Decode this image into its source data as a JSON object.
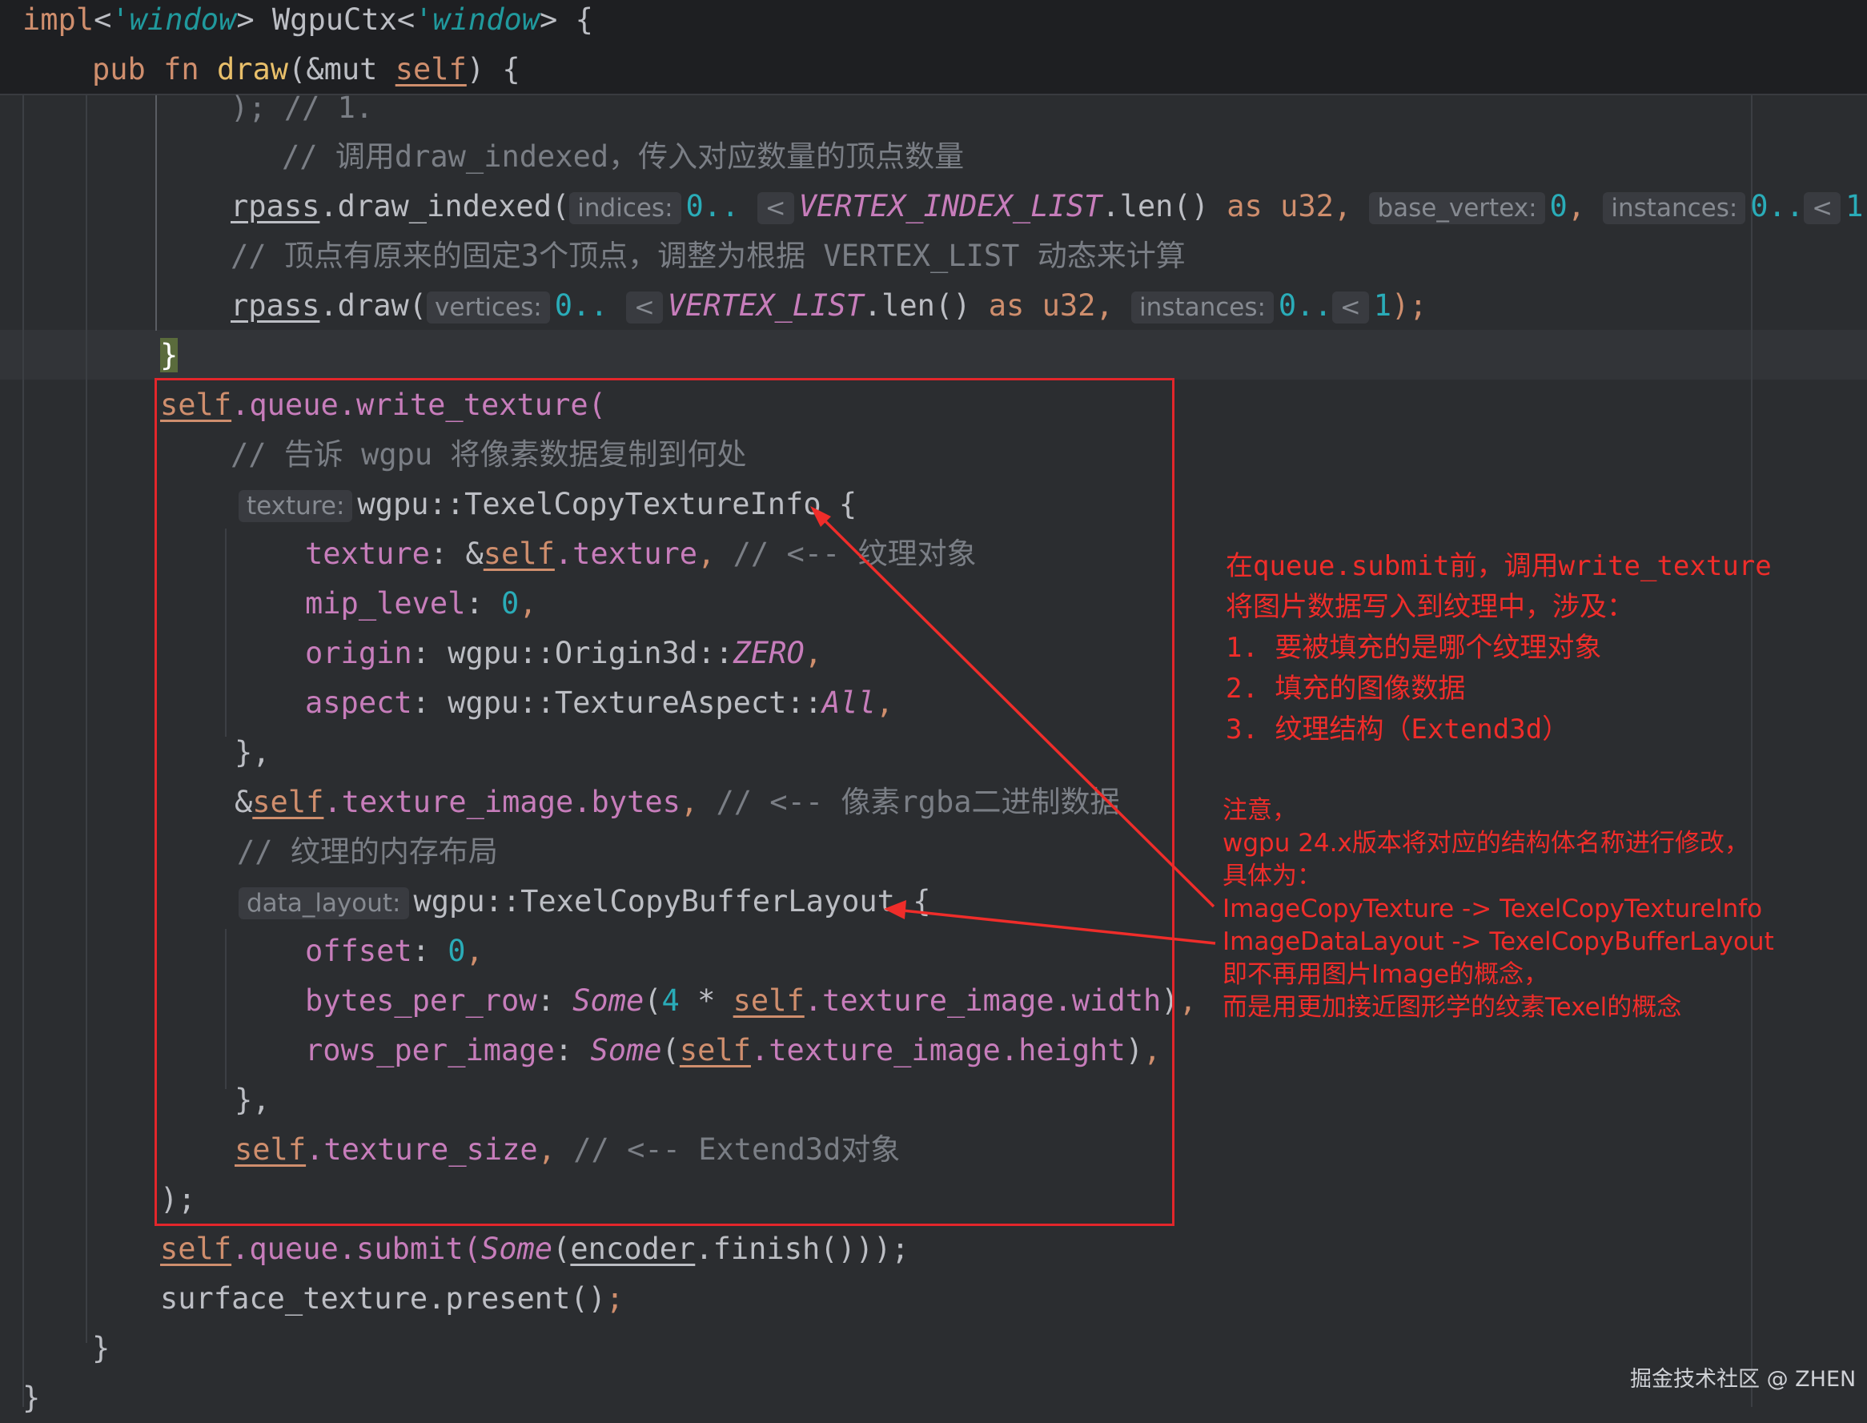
{
  "editor": {
    "sticky": {
      "impl_kw": "impl",
      "impl_lt1": "'window",
      "impl_type": "WgpuCtx<",
      "impl_lt2": "'window",
      "impl_tail": "> {",
      "fn_kw": "pub fn",
      "fn_name": "draw",
      "fn_params_a": "(&mut ",
      "fn_self": "self",
      "fn_params_b": ") {"
    },
    "lines": {
      "l_partial": "); // 1.",
      "l_cmt1": "// 调用draw_indexed，传入对应数量的顶点数量",
      "l_rpass1": "rpass",
      "l_draw_indexed": ".draw_indexed(",
      "h_indices": "indices:",
      "l_range1": "0..",
      "l_lt1": "<",
      "l_vil": "VERTEX_INDEX_LIST",
      "l_len1": ".len() ",
      "l_as1": "as u32",
      "l_comma": ",",
      "h_base_vertex": "base_vertex:",
      "l_zero": "0",
      "h_instances": "instances:",
      "l_range2": "0..",
      "l_one": "1",
      "l_close1": ");",
      "l_cmt2": "// 顶点有原来的固定3个顶点，调整为根据 VERTEX_LIST 动态来计算",
      "l_rpass2": "rpass",
      "l_draw": ".draw(",
      "h_vertices": "vertices:",
      "l_vl": "VERTEX_LIST",
      "l_brace_close": "}",
      "l_self_queue": ".queue.write_texture(",
      "l_cmt3": "// 告诉 wgpu 将像素数据复制到何处",
      "h_texture": "texture:",
      "l_tcti": "wgpu::TexelCopyTextureInfo {",
      "l_tex_field": "texture",
      "l_tex_val": ": &",
      "l_tex_val2": ".texture",
      "l_cmt4": "// <-- 纹理对象",
      "l_mip": "mip_level",
      "l_origin": "origin",
      "l_origin_val": ": wgpu::Origin3d::",
      "l_zero_const": "ZERO",
      "l_aspect": "aspect",
      "l_aspect_val": ": wgpu::TextureAspect::",
      "l_all": "All",
      "l_close_brace_comma": "},",
      "l_bytes_a": "&",
      "l_bytes_b": ".texture_image.bytes",
      "l_cmt5": "// <-- 像素rgba二进制数据",
      "l_cmt6": "// 纹理的内存布局",
      "h_data_layout": "data_layout:",
      "l_tcbl": "wgpu::TexelCopyBufferLayout {",
      "l_offset": "offset",
      "l_bpr": "bytes_per_row",
      "l_some": "Some",
      "l_four": "4",
      "l_star": " * ",
      "l_width": ".texture_image.width",
      "l_rpi": "rows_per_image",
      "l_height": ".texture_image.height",
      "l_tsize": ".texture_size",
      "l_cmt7": "// <-- Extend3d对象",
      "l_paren_semi": ");",
      "l_submit_a": ".queue.submit(",
      "l_encoder": "encoder",
      "l_finish": ".finish()));",
      "l_surface": "surface_texture.present()",
      "l_semi": ";",
      "l_fn_close": "}",
      "l_impl_close": "}",
      "self_word": "self"
    }
  },
  "annotation": {
    "note1": "在queue.submit前，调用write_texture\n将图片数据写入到纹理中，涉及：\n1. 要被填充的是哪个纹理对象\n2. 填充的图像数据\n3. 纹理结构（Extend3d）",
    "note2": "注意，\nwgpu 24.x版本将对应的结构体名称进行修改，\n具体为：\nImageCopyTexture -> TexelCopyTextureInfo\nImageDataLayout -> TexelCopyBufferLayout\n即不再用图片Image的概念，\n而是用更加接近图形学的纹素Texel的概念",
    "color": "#ef2d2a"
  },
  "watermark": "掘金技术社区 @ ZHEN"
}
